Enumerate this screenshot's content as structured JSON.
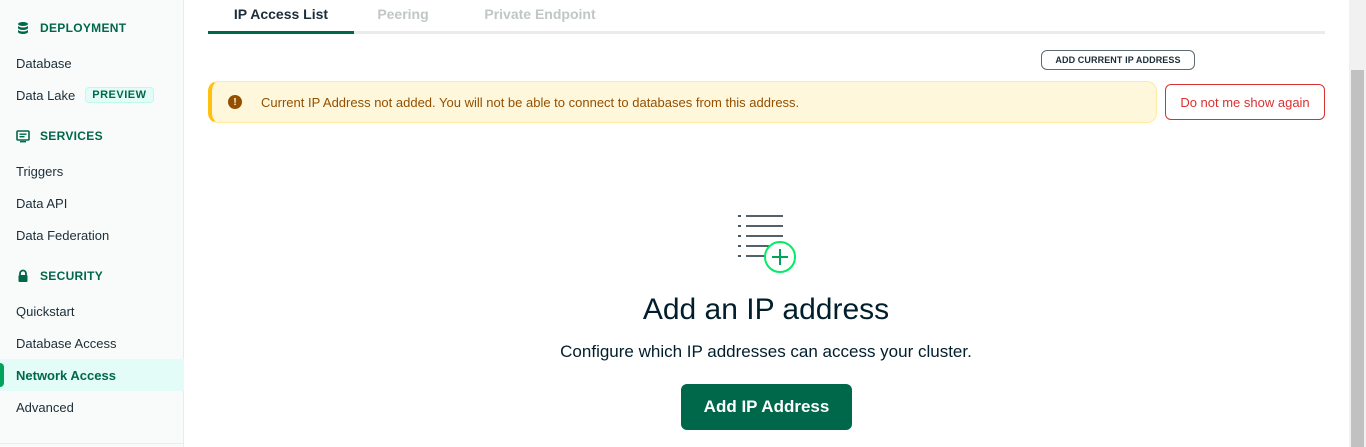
{
  "sidebar": {
    "sections": [
      {
        "title": "DEPLOYMENT",
        "icon": "database-icon"
      },
      {
        "title": "SERVICES",
        "icon": "services-icon"
      },
      {
        "title": "SECURITY",
        "icon": "lock-icon"
      }
    ],
    "items": [
      {
        "label": "Database"
      },
      {
        "label": "Data Lake",
        "badge": "PREVIEW"
      },
      {
        "label": "Triggers"
      },
      {
        "label": "Data API"
      },
      {
        "label": "Data Federation"
      },
      {
        "label": "Quickstart"
      },
      {
        "label": "Database Access"
      },
      {
        "label": "Network Access",
        "active": true
      },
      {
        "label": "Advanced"
      }
    ]
  },
  "tabs": [
    {
      "label": "IP Access List",
      "active": true
    },
    {
      "label": "Peering"
    },
    {
      "label": "Private Endpoint"
    }
  ],
  "toolbar": {
    "add_current_ip_label": "ADD CURRENT IP ADDRESS"
  },
  "banner": {
    "message": "Current IP Address not added. You will not be able to connect to databases from this address.",
    "icon": "warning-icon",
    "dismiss_label": "Do not me show again"
  },
  "empty_state": {
    "icon": "list-add-icon",
    "title": "Add an IP address",
    "subtitle": "Configure which IP addresses can access your cluster.",
    "button_label": "Add IP Address"
  },
  "colors": {
    "brand_green": "#00684a",
    "accent_green": "#00a35c",
    "warning_bg": "#fef7db",
    "warning_text": "#944f01",
    "danger": "#db3030"
  }
}
